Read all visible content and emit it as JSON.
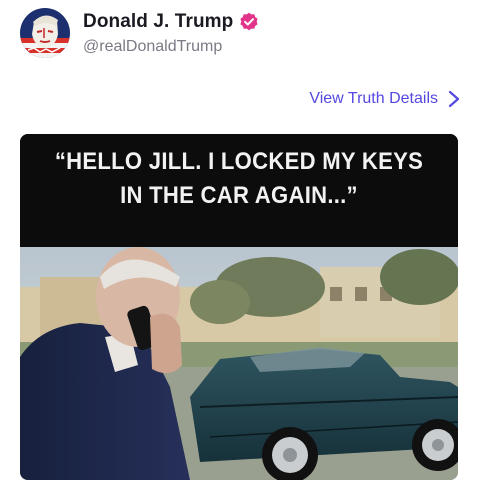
{
  "profile": {
    "display_name": "Donald J. Trump",
    "handle": "@realDonaldTrump",
    "verified_color": "#e0358a"
  },
  "actions": {
    "details_label": "View Truth Details"
  },
  "media": {
    "caption_line1": "“HELLO JILL. I LOCKED MY KEYS",
    "caption_line2": "IN THE CAR AGAIN...”"
  },
  "colors": {
    "accent": "#5449e0",
    "name_text": "#1a1a22",
    "handle_text": "#7a7a85"
  }
}
